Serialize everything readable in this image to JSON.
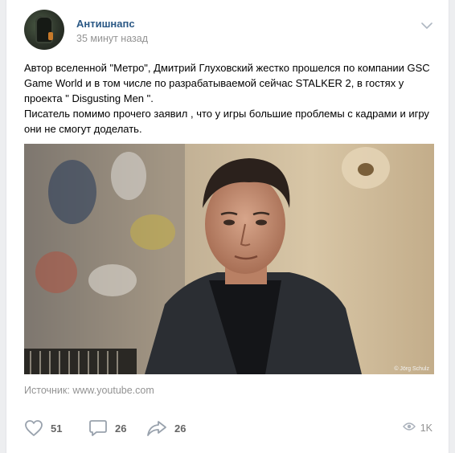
{
  "post": {
    "author": "Антишнапс",
    "time": "35 минут назад",
    "paragraph_1": "Автор вселенной \"Метро\", Дмитрий Глуховский жестко прошелся по компании GSC Game World и в том числе по разрабатываемой сейчас STALKER 2, в гостях у проекта \" Disgusting Men \".",
    "paragraph_2": "Писатель помимо прочего заявил , что у игры большие проблемы с кадрами и игру они не смогут доделать.",
    "photo_credit": "© Jörg Schulz",
    "source_label": "Источник:",
    "source_link": "www.youtube.com"
  },
  "actions": {
    "likes": "51",
    "comments": "26",
    "shares": "26",
    "views": "1K"
  },
  "icons": {
    "menu": "chevron-down-icon",
    "like": "heart-icon",
    "comment": "comment-icon",
    "share": "share-arrow-icon",
    "views": "eye-icon"
  },
  "colors": {
    "author_link": "#2a5885",
    "muted": "#939393",
    "counter": "#656565",
    "icon": "#99a2ad"
  }
}
